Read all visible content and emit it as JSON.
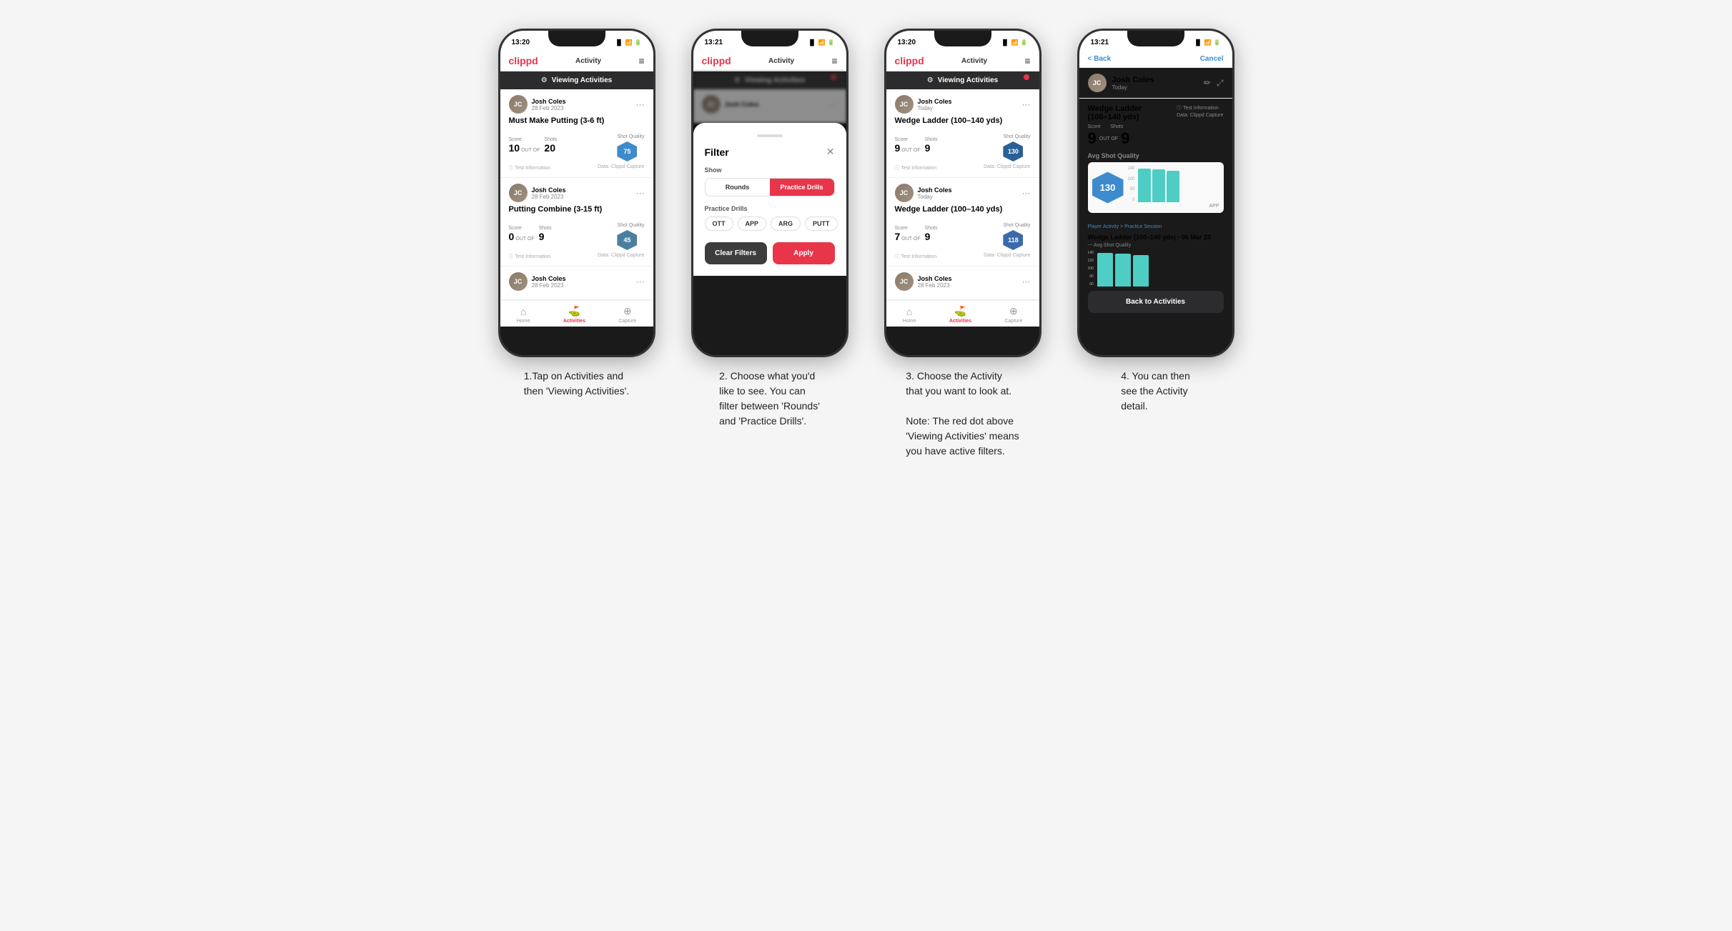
{
  "page": {
    "background": "#f5f5f5"
  },
  "phones": [
    {
      "id": "phone1",
      "status_bar": {
        "time": "13:20",
        "icons": "▐▌▐ ✦",
        "dark": false
      },
      "nav": {
        "logo": "clippd",
        "center": "Activity",
        "menu": "≡"
      },
      "banner": {
        "text": "Viewing Activities",
        "has_dot": false
      },
      "cards": [
        {
          "user": "Josh Coles",
          "date": "28 Feb 2023",
          "title": "Must Make Putting (3-6 ft)",
          "score_label": "Score",
          "score": "10",
          "shots_label": "Shots",
          "shots": "20",
          "quality_label": "Shot Quality",
          "quality": "75",
          "footer_left": "ⓘ Test Information",
          "footer_right": "Data: Clippd Capture"
        },
        {
          "user": "Josh Coles",
          "date": "28 Feb 2023",
          "title": "Putting Combine (3-15 ft)",
          "score_label": "Score",
          "score": "0",
          "shots_label": "Shots",
          "shots": "9",
          "quality_label": "Shot Quality",
          "quality": "45",
          "footer_left": "ⓘ Test Information",
          "footer_right": "Data: Clippd Capture"
        },
        {
          "user": "Josh Coles",
          "date": "28 Feb 2023",
          "title": "",
          "truncated": true
        }
      ],
      "tabs": [
        {
          "label": "Home",
          "icon": "⌂",
          "active": false
        },
        {
          "label": "Activities",
          "icon": "⛳",
          "active": true
        },
        {
          "label": "Capture",
          "icon": "⊕",
          "active": false
        }
      ]
    },
    {
      "id": "phone2",
      "status_bar": {
        "time": "13:21",
        "dark": false
      },
      "nav": {
        "logo": "clippd",
        "center": "Activity",
        "menu": "≡"
      },
      "blurred_banner": {
        "text": "Viewing Activities",
        "has_dot": true
      },
      "blurred_card": {
        "user": "Josh Coles",
        "truncated": true
      },
      "modal": {
        "title": "Filter",
        "show_label": "Show",
        "toggles": [
          "Rounds",
          "Practice Drills"
        ],
        "active_toggle": "Practice Drills",
        "practice_drills_label": "Practice Drills",
        "chips": [
          "OTT",
          "APP",
          "ARG",
          "PUTT"
        ],
        "clear_label": "Clear Filters",
        "apply_label": "Apply"
      }
    },
    {
      "id": "phone3",
      "status_bar": {
        "time": "13:20",
        "dark": false
      },
      "nav": {
        "logo": "clippd",
        "center": "Activity",
        "menu": "≡"
      },
      "banner": {
        "text": "Viewing Activities",
        "has_dot": true
      },
      "cards": [
        {
          "user": "Josh Coles",
          "date": "Today",
          "title": "Wedge Ladder (100–140 yds)",
          "score_label": "Score",
          "score": "9",
          "shots_label": "Shots",
          "shots": "9",
          "quality_label": "Shot Quality",
          "quality": "130",
          "footer_left": "ⓘ Test Information",
          "footer_right": "Data: Clippd Capture"
        },
        {
          "user": "Josh Coles",
          "date": "Today",
          "title": "Wedge Ladder (100–140 yds)",
          "score_label": "Score",
          "score": "7",
          "shots_label": "Shots",
          "shots": "9",
          "quality_label": "Shot Quality",
          "quality": "118",
          "footer_left": "ⓘ Test Information",
          "footer_right": "Data: Clippd Capture"
        },
        {
          "user": "Josh Coles",
          "date": "28 Feb 2023",
          "title": "",
          "truncated": true
        }
      ],
      "tabs": [
        {
          "label": "Home",
          "icon": "⌂",
          "active": false
        },
        {
          "label": "Activities",
          "icon": "⛳",
          "active": true
        },
        {
          "label": "Capture",
          "icon": "⊕",
          "active": false
        }
      ]
    },
    {
      "id": "phone4",
      "status_bar": {
        "time": "13:21",
        "dark": false
      },
      "nav": {
        "back": "< Back",
        "cancel": "Cancel"
      },
      "detail": {
        "user": "Josh Coles",
        "date": "Today",
        "drill_title": "Wedge Ladder\n(100–140 yds)",
        "score_label": "Score",
        "score": "9",
        "out_of": "OUT OF",
        "shots": "9",
        "shots_label": "Shots",
        "info_left": "ⓘ Test Information",
        "info_right": "Data: Clippd Capture",
        "avg_quality_label": "Avg Shot Quality",
        "quality_value": "130",
        "chart_label": "APP",
        "chart_bars": [
          132,
          129,
          124
        ],
        "chart_axis": [
          "140",
          "120",
          "100",
          "80",
          "60"
        ],
        "session_label": "Player Activity",
        "session_type": "Practice Session",
        "sub_title": "Wedge Ladder (100–140 yds) - 06 Mar 23",
        "sub_label": "--- Avg Shot Quality",
        "back_to_activities": "Back to Activities"
      }
    }
  ],
  "captions": [
    "1.Tap on Activities and\nthen 'Viewing Activities'.",
    "2. Choose what you'd\nlike to see. You can\nfilter between 'Rounds'\nand 'Practice Drills'.",
    "3. Choose the Activity\nthat you want to look at.\n\nNote: The red dot above\n'Viewing Activities' means\nyou have active filters.",
    "4. You can then\nsee the Activity\ndetail."
  ]
}
